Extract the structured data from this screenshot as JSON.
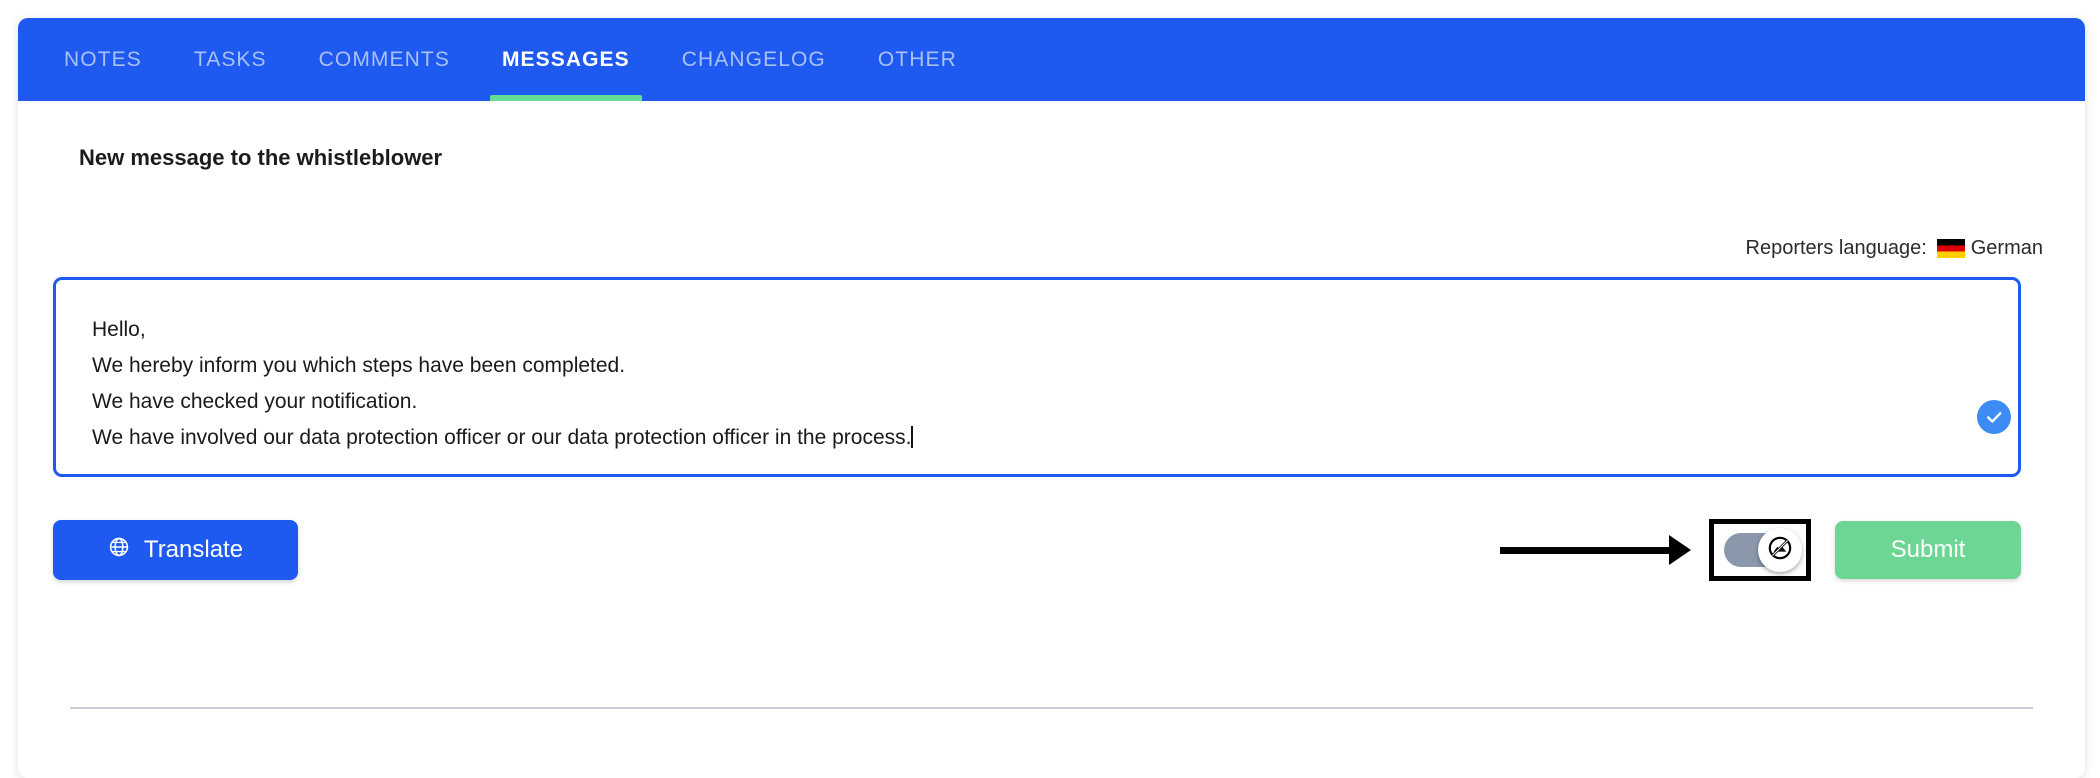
{
  "tabs": [
    {
      "label": "NOTES",
      "active": false
    },
    {
      "label": "TASKS",
      "active": false
    },
    {
      "label": "COMMENTS",
      "active": false
    },
    {
      "label": "MESSAGES",
      "active": true
    },
    {
      "label": "CHANGELOG",
      "active": false
    },
    {
      "label": "OTHER",
      "active": false
    }
  ],
  "section": {
    "title": "New message to the whistleblower"
  },
  "language": {
    "label": "Reporters language:",
    "flag_icon": "german-flag-icon",
    "value": "German"
  },
  "message": {
    "line1": "Hello,",
    "line2": "We hereby inform you which steps have been completed.",
    "line3": "We have checked your notification.",
    "line4": "We have involved our data protection officer or our data protection officer in the process.",
    "placeholder": "",
    "status_icon": "check-circle-icon"
  },
  "actions": {
    "translate_label": "Translate",
    "translate_icon": "globe-icon",
    "submit_label": "Submit",
    "toggle": {
      "name": "anonymize-toggle",
      "state": "off",
      "knob_icon": "image-off-icon"
    },
    "annotation_arrow_icon": "arrow-right-icon"
  },
  "colors": {
    "brand_blue": "#1f5af0",
    "accent_green": "#63dd96",
    "submit_green": "#6dd694",
    "inactive_tab": "#a9c1f7",
    "toggle_track": "#8b98ac",
    "check_blue": "#3d8bf5",
    "divider": "#c8cdd6"
  }
}
